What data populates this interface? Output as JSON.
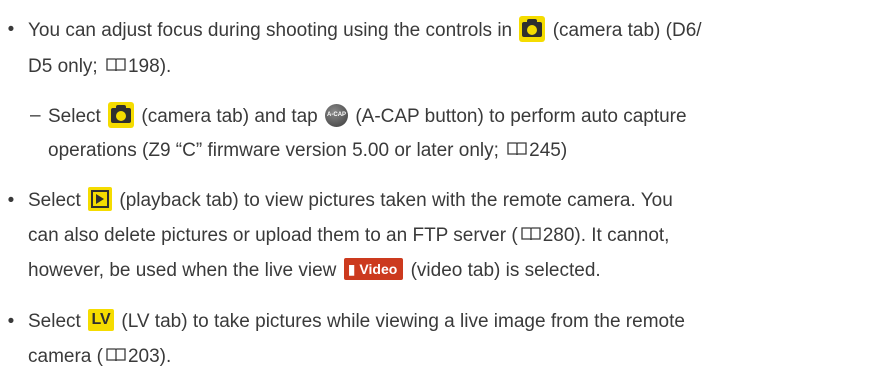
{
  "bullets": {
    "symbol": "•",
    "dash": "–",
    "b1": {
      "a": "You can adjust focus during shooting using the controls in",
      "b": "(camera tab) (D6/",
      "c": "D5 only;",
      "page": "198",
      "d": ")."
    },
    "sub": {
      "a": "Select",
      "b": "(camera tab) and tap",
      "c": "(A-CAP button) to perform auto capture",
      "d": "operations (Z9 “C” firmware version 5.00 or later only;",
      "page": "245",
      "e": ")"
    },
    "b2": {
      "a": "Select",
      "b": "(playback tab) to view pictures taken with the remote camera. You",
      "c": "can also delete pictures or upload them to an FTP server (",
      "page": "280",
      "d": "). It cannot,",
      "e": "however, be used when the live view",
      "f": "(video tab) is selected."
    },
    "b3": {
      "a": "Select",
      "b": "(LV tab) to take pictures while viewing a live image from the remote",
      "c": "camera (",
      "page": "203",
      "d": ")."
    }
  },
  "icons": {
    "acap_text": "A-CAP",
    "video_text": "Video",
    "lv_text": "LV"
  },
  "colors": {
    "tab_yellow": "#f5dc00",
    "video_red": "#cc3a1e",
    "text": "#3a3a3a"
  }
}
